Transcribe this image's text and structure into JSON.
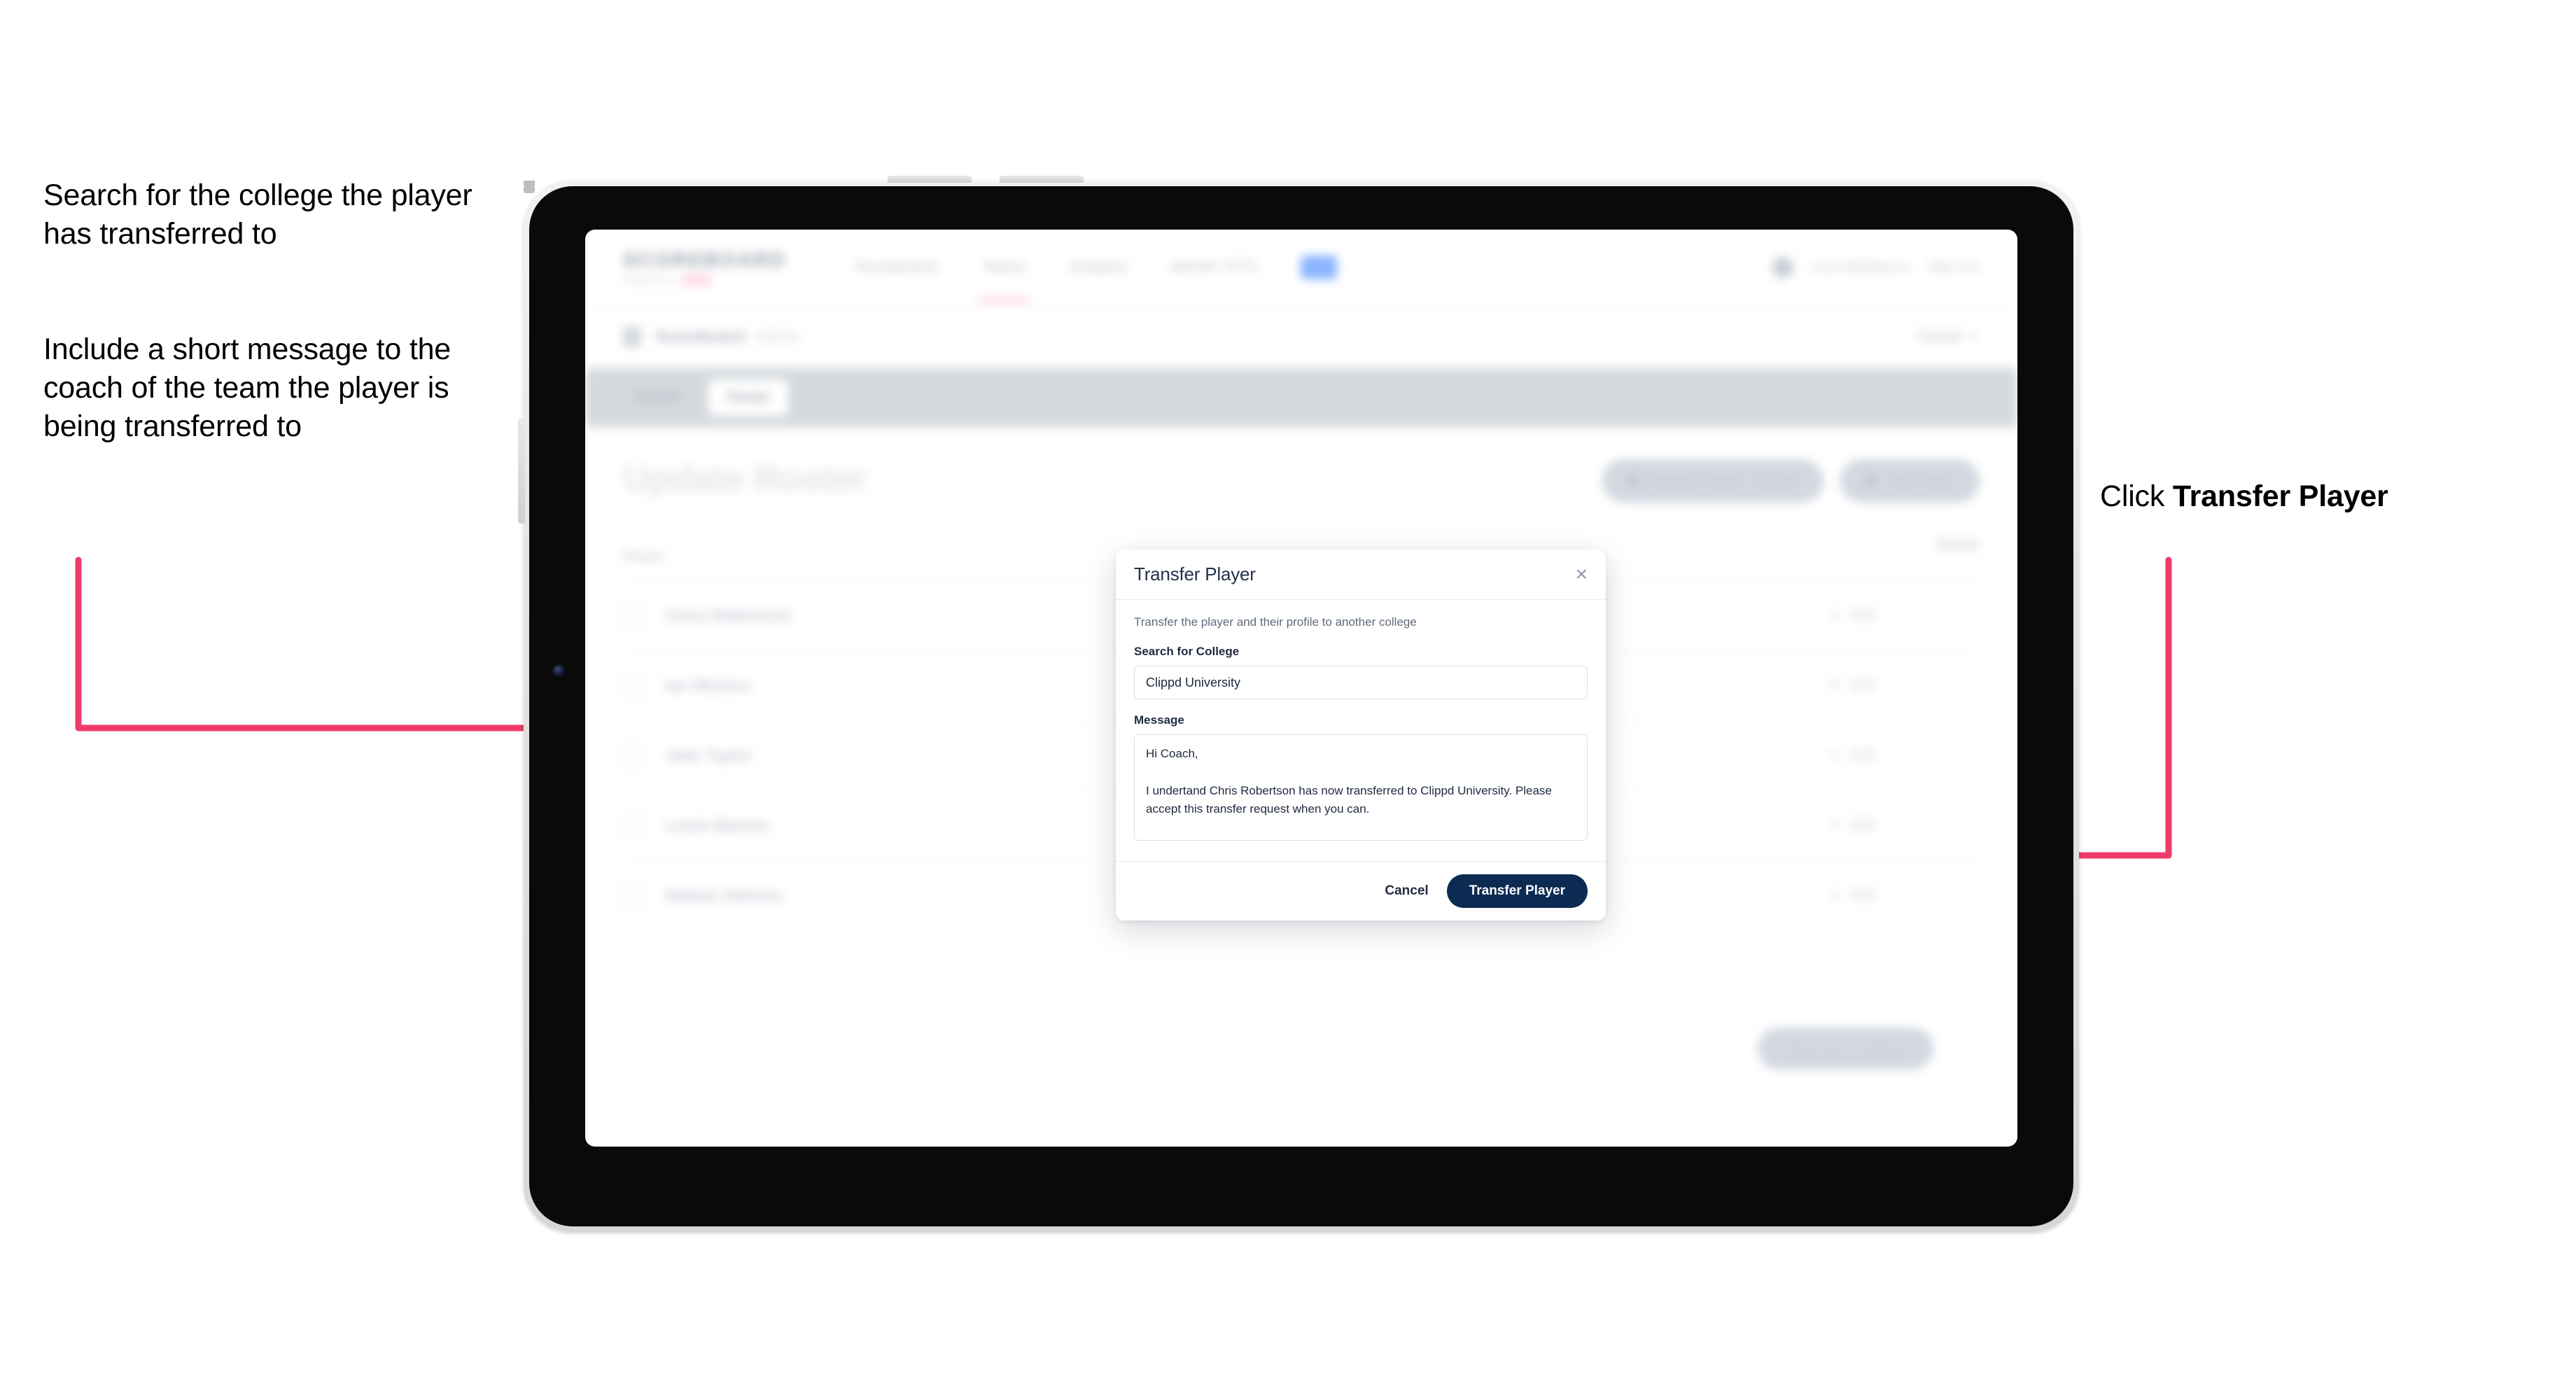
{
  "annotations": {
    "left_1": "Search for the college the player has transferred to",
    "left_2": "Include a short message to the coach of the team the player is being transferred to",
    "right_1_prefix": "Click ",
    "right_1_bold": "Transfer Player",
    "arrow_color": "#ef3a6b"
  },
  "app": {
    "brand": {
      "name": "SCOREBOARD",
      "subtitle": "Powered by",
      "chip": ""
    },
    "nav": [
      {
        "label": "Tournaments"
      },
      {
        "label": "Teams"
      },
      {
        "label": "Analytics"
      },
      {
        "label": "WAGR / PTS"
      },
      {
        "label": ""
      }
    ],
    "user": {
      "name": "coach@clippd.io",
      "sign_out": "Sign Out"
    },
    "breadcrumb": {
      "main": "Scoreboard",
      "sub": "Admin",
      "cancel": "Cancel"
    },
    "tabs": [
      {
        "label": "Details",
        "active": false
      },
      {
        "label": "Roster",
        "active": true
      }
    ],
    "page_title": "Update Roster",
    "top_actions": [
      {
        "label": "Request Player Transfer",
        "icon": "transfer-icon"
      },
      {
        "label": "Add Player",
        "icon": "plus-icon"
      }
    ],
    "roster": {
      "col_left": "Player",
      "col_right": "WAGR",
      "rows": [
        {
          "name": "Chris Robertson",
          "action": "Edit"
        },
        {
          "name": "Ian Winters",
          "action": "Edit"
        },
        {
          "name": "Jake Taylor",
          "action": "Edit"
        },
        {
          "name": "Lewis Barnes",
          "action": "Edit"
        },
        {
          "name": "Nathan Holmes",
          "action": "Edit"
        }
      ]
    },
    "bottom_action": "Save And Continue"
  },
  "modal": {
    "title": "Transfer Player",
    "close_icon": "×",
    "description": "Transfer the player and their profile to another college",
    "college_label": "Search for College",
    "college_value": "Clippd University",
    "college_placeholder": "Search for College",
    "message_label": "Message",
    "message_value": "Hi Coach,\n\nI undertand Chris Robertson has now transferred to Clippd University. Please accept this transfer request when you can.",
    "message_placeholder": "Message",
    "cancel_label": "Cancel",
    "submit_label": "Transfer Player",
    "submit_color": "#0c2b52"
  }
}
